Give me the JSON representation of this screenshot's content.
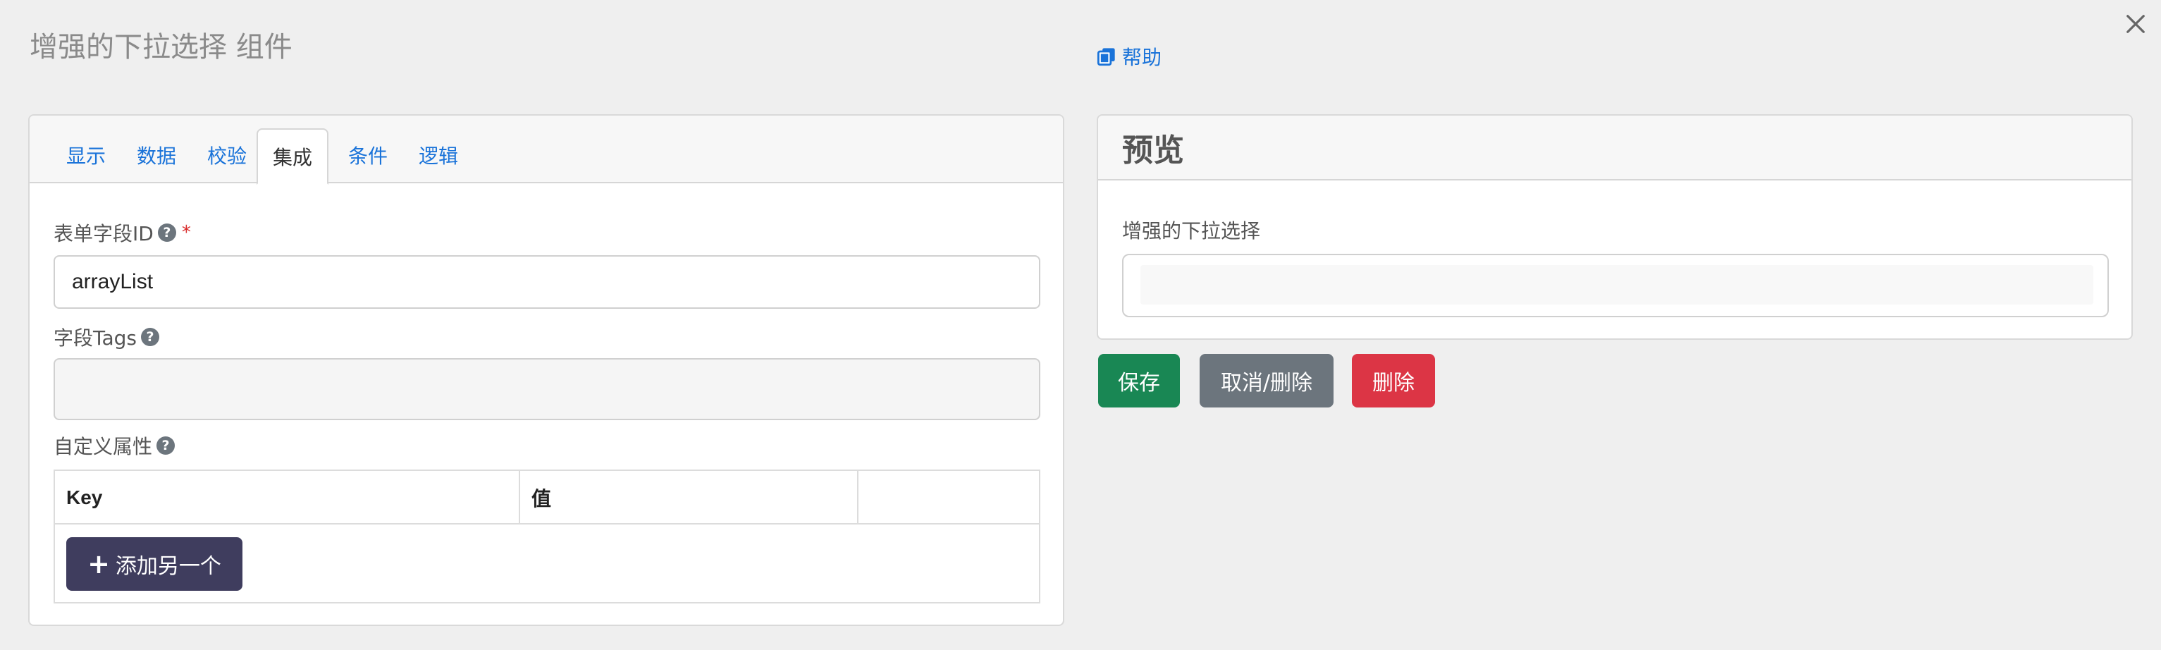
{
  "modal": {
    "title": "增强的下拉选择 组件"
  },
  "help": {
    "label": "帮助"
  },
  "tabs": [
    {
      "label": "显示"
    },
    {
      "label": "数据"
    },
    {
      "label": "校验"
    },
    {
      "label": "集成"
    },
    {
      "label": "条件"
    },
    {
      "label": "逻辑"
    }
  ],
  "active_tab": "集成",
  "form": {
    "field_id": {
      "label": "表单字段ID",
      "required_mark": "*",
      "value": "arrayList"
    },
    "field_tags": {
      "label": "字段Tags",
      "value": ""
    },
    "custom_props": {
      "label": "自定义属性",
      "columns": [
        "Key",
        "值",
        ""
      ],
      "add_button_label": "添加另一个"
    }
  },
  "preview": {
    "header": "预览",
    "component_label": "增强的下拉选择"
  },
  "actions": {
    "save_label": "保存",
    "cancel_label": "取消/删除",
    "delete_label": "删除"
  },
  "colors": {
    "link": "#1a73d9",
    "save": "#198754",
    "cancel": "#6c757d",
    "delete": "#dc3545",
    "add_button": "#3f3d5e"
  }
}
